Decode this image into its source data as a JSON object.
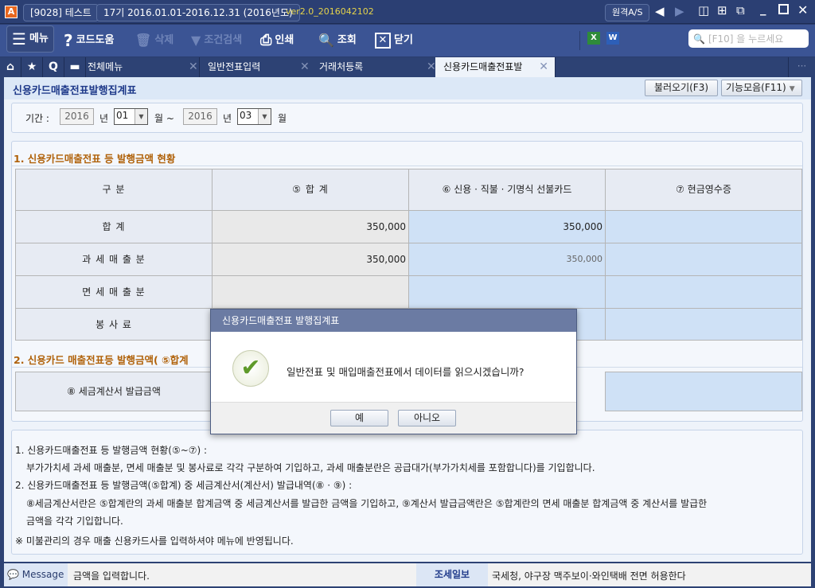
{
  "titlebar": {
    "company": "[9028] 테스트",
    "period": "17기  2016.01.01-2016.12.31  (2016년도)",
    "version": "ver2.0_2016042102",
    "remote_as": "원격A/S"
  },
  "toolbar": {
    "menu": "메뉴",
    "code_help": "코드도움",
    "delete": "삭제",
    "search_cond": "조건검색",
    "print": "인쇄",
    "inquiry": "조회",
    "close": "닫기",
    "search_placeholder": "[F10] 을 누르세요"
  },
  "tabs": [
    {
      "label": "전체메뉴"
    },
    {
      "label": "일반전표입력"
    },
    {
      "label": "거래처등록"
    },
    {
      "label": "신용카드매출전표발"
    }
  ],
  "page": {
    "title": "신용카드매출전표발행집계표",
    "load_button": "불러오기(F3)",
    "functions_button": "기능모음(F11)"
  },
  "period": {
    "label": "기간 :",
    "from_year": "2016",
    "year_unit": "년",
    "from_month": "01",
    "month_unit": "월 ~",
    "to_year": "2016",
    "to_month": "03",
    "month_unit2": "월"
  },
  "section1": {
    "title": "1. 신용카드매출전표 등 발행금액 현황",
    "headers": [
      "구          분",
      "⑤ 합             계",
      "⑥ 신용 · 직불 · 기명식 선불카드",
      "⑦ 현금영수증"
    ],
    "rows": [
      {
        "label": "합          계",
        "total": "350,000",
        "card": "350,000",
        "cash": ""
      },
      {
        "label": "과 세 매 출 분",
        "total": "350,000",
        "card": "350,000",
        "cash": ""
      },
      {
        "label": "면 세 매 출 분",
        "total": "",
        "card": "",
        "cash": ""
      },
      {
        "label": "봉     사     료",
        "total": "",
        "card": "",
        "cash": ""
      }
    ]
  },
  "section2": {
    "title": "2. 신용카드 매출전표등 발행금액( ⑤합계",
    "row_label": "⑧ 세금계산서 발급금액"
  },
  "notes": [
    "1. 신용카드매출전표 등 발행금액 현황(⑤~⑦) :",
    "부가가치세 과세 매출분, 면세 매출분 및 봉사료로 각각 구분하여 기입하고, 과세 매출분란은 공급대가(부가가치세를 포함합니다)를 기입합니다.",
    "2. 신용카드매출전표 등 발행금액(⑤합계) 중 세금계산서(계산서) 발급내역(⑧ · ⑨) :",
    "⑧세금계산서란은 ⑤합계란의 과세 매출분 합계금액 중 세금계산서를 발급한 금액을 기입하고, ⑨계산서  발급금액란은 ⑤합계란의 면세 매출분 합계금액 중 계산서를 발급한",
    "금액을 각각 기입합니다.",
    "※ 미불관리의 경우 매출 신용카드사를 입력하셔야 메뉴에 반영됩니다."
  ],
  "status": {
    "message_label": "Message",
    "message": "금액을 입력합니다.",
    "news_label": "조세일보",
    "news": "국세청, 야구장 맥주보이·와인택배 전면 허용한다"
  },
  "dialog": {
    "title": "신용카드매출전표 발행집계표",
    "message": "일반전표 및 매입매출전표에서 데이터를 읽으시겠습니까?",
    "yes": "예",
    "no": "아니오"
  },
  "colors": {
    "accent": "#3b5494",
    "section": "#b0620a",
    "blue_cell": "#cfe1f6"
  }
}
